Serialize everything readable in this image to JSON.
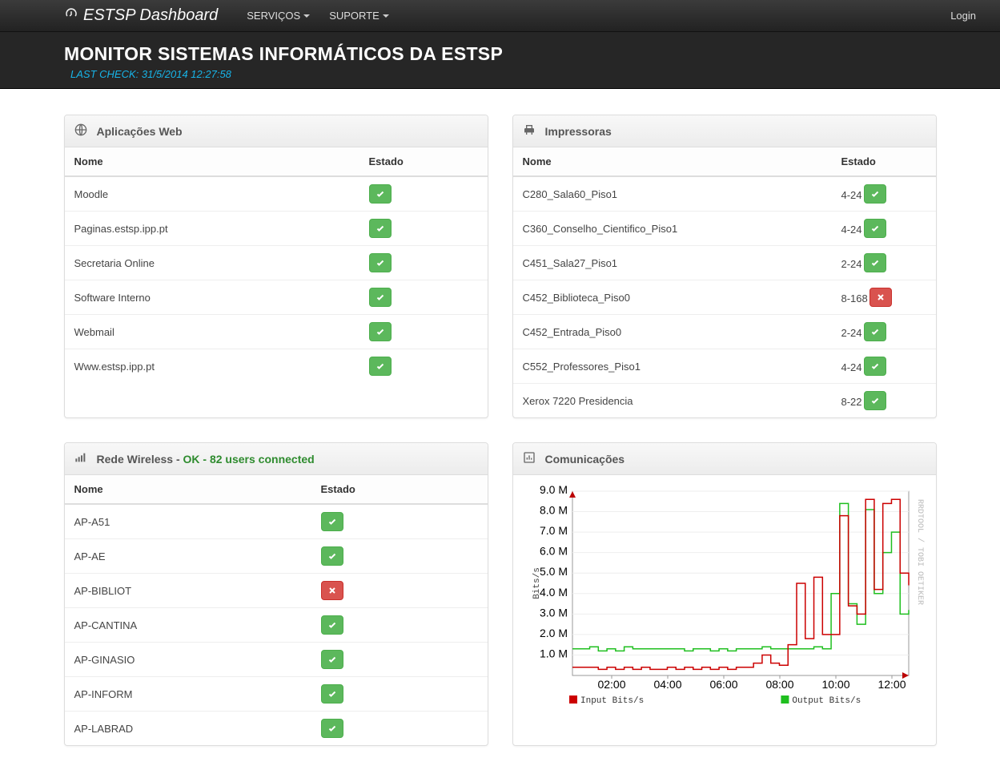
{
  "navbar": {
    "brand": "ESTSP Dashboard",
    "items": [
      {
        "label": "SERVIÇOS"
      },
      {
        "label": "SUPORTE"
      }
    ],
    "login": "Login"
  },
  "header": {
    "title": "MONITOR SISTEMAS INFORMÁTICOS DA ESTSP",
    "subtitle": "LAST CHECK: 31/5/2014 12:27:58"
  },
  "col_nome": "Nome",
  "col_estado": "Estado",
  "apps": {
    "title": "Aplicações Web",
    "rows": [
      {
        "name": "Moodle",
        "status": "ok"
      },
      {
        "name": "Paginas.estsp.ipp.pt",
        "status": "ok"
      },
      {
        "name": "Secretaria Online",
        "status": "ok"
      },
      {
        "name": "Software Interno",
        "status": "ok"
      },
      {
        "name": "Webmail",
        "status": "ok"
      },
      {
        "name": "Www.estsp.ipp.pt",
        "status": "ok"
      }
    ]
  },
  "printers": {
    "title": "Impressoras",
    "rows": [
      {
        "name": "C280_Sala60_Piso1",
        "prefix": "4-24",
        "status": "ok"
      },
      {
        "name": "C360_Conselho_Cientifico_Piso1",
        "prefix": "4-24",
        "status": "ok"
      },
      {
        "name": "C451_Sala27_Piso1",
        "prefix": "2-24",
        "status": "ok"
      },
      {
        "name": "C452_Biblioteca_Piso0",
        "prefix": "8-168",
        "status": "fail"
      },
      {
        "name": "C452_Entrada_Piso0",
        "prefix": "2-24",
        "status": "ok"
      },
      {
        "name": "C552_Professores_Piso1",
        "prefix": "4-24",
        "status": "ok"
      },
      {
        "name": "Xerox 7220 Presidencia",
        "prefix": "8-22",
        "status": "ok"
      }
    ]
  },
  "wireless": {
    "title": "Rede Wireless - ",
    "status_msg": "OK - 82 users connected",
    "rows": [
      {
        "name": "AP-A51",
        "status": "ok"
      },
      {
        "name": "AP-AE",
        "status": "ok"
      },
      {
        "name": "AP-BIBLIOT",
        "status": "fail"
      },
      {
        "name": "AP-CANTINA",
        "status": "ok"
      },
      {
        "name": "AP-GINASIO",
        "status": "ok"
      },
      {
        "name": "AP-INFORM",
        "status": "ok"
      },
      {
        "name": "AP-LABRAD",
        "status": "ok"
      }
    ]
  },
  "comms": {
    "title": "Comunicações",
    "watermark": "RRDTOOL / TOBI OETIKER"
  },
  "chart_data": {
    "type": "line",
    "ylabel": "Bits/s",
    "ylim": [
      0,
      9
    ],
    "yunit": "M",
    "yticks": [
      1,
      2,
      3,
      4,
      5,
      6,
      7,
      8,
      9
    ],
    "xticks": [
      "02:00",
      "04:00",
      "06:00",
      "08:00",
      "10:00",
      "12:00"
    ],
    "legend": {
      "input": "Input Bits/s",
      "output": "Output Bits/s"
    },
    "colors": {
      "input": "#cc0000",
      "output": "#1fbf1f"
    },
    "x": [
      0,
      1,
      2,
      3,
      4,
      5,
      6,
      7,
      8,
      9,
      10,
      11,
      12,
      13,
      14,
      15,
      16,
      17,
      18,
      19,
      20,
      21,
      22,
      23,
      24,
      25,
      26,
      27,
      28,
      29,
      30,
      31,
      32,
      33,
      34,
      35,
      36,
      37,
      38,
      39
    ],
    "series": [
      {
        "name": "input",
        "values": [
          0.4,
          0.4,
          0.4,
          0.3,
          0.4,
          0.3,
          0.4,
          0.3,
          0.4,
          0.3,
          0.3,
          0.4,
          0.3,
          0.4,
          0.3,
          0.4,
          0.3,
          0.4,
          0.3,
          0.4,
          0.4,
          0.6,
          1.0,
          0.6,
          0.5,
          1.5,
          4.5,
          1.8,
          4.8,
          2.0,
          2.0,
          7.8,
          3.4,
          3.0,
          8.6,
          4.2,
          8.4,
          8.6,
          5.0,
          4.4
        ]
      },
      {
        "name": "output",
        "values": [
          1.3,
          1.3,
          1.4,
          1.2,
          1.3,
          1.2,
          1.4,
          1.3,
          1.3,
          1.3,
          1.3,
          1.3,
          1.3,
          1.2,
          1.3,
          1.3,
          1.2,
          1.3,
          1.2,
          1.3,
          1.3,
          1.3,
          1.4,
          1.3,
          1.3,
          1.3,
          1.3,
          1.3,
          1.4,
          1.3,
          4.0,
          8.4,
          3.5,
          2.5,
          8.1,
          4.0,
          6.0,
          7.0,
          3.0,
          3.2
        ]
      }
    ]
  }
}
